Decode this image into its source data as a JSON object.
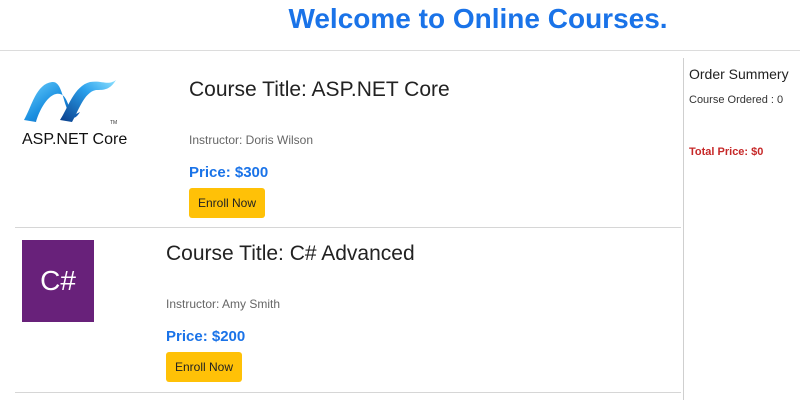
{
  "header": {
    "title": "Welcome to Online Courses."
  },
  "courses": [
    {
      "logo_label": "ASP.NET Core",
      "logo_icon": "aspnet-logo-icon",
      "title": "Course Title: ASP.NET Core",
      "instructor": "Instructor: Doris Wilson",
      "price": "Price: $300",
      "enroll_label": "Enroll Now"
    },
    {
      "logo_label": "C#",
      "logo_icon": "csharp-logo-icon",
      "title": "Course Title: C# Advanced",
      "instructor": "Instructor: Amy Smith",
      "price": "Price: $200",
      "enroll_label": "Enroll Now"
    }
  ],
  "sidebar": {
    "title": "Order Summery",
    "count_text": "Course Ordered : 0",
    "total_text": "Total Price: $0"
  },
  "colors": {
    "accent": "#1a73e8",
    "button": "#ffc107",
    "total": "#c62828",
    "csharp_logo": "#68217a"
  }
}
